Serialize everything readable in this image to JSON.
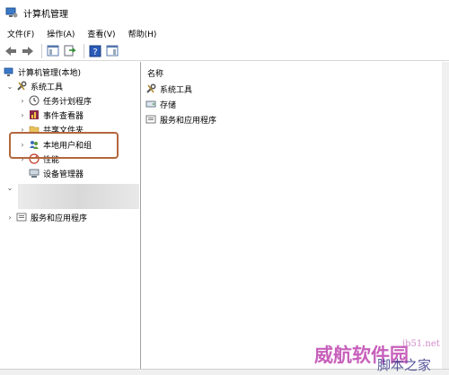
{
  "window": {
    "title": "计算机管理"
  },
  "menu": [
    {
      "label": "文件(F)"
    },
    {
      "label": "操作(A)"
    },
    {
      "label": "查看(V)"
    },
    {
      "label": "帮助(H)"
    }
  ],
  "toolbar": {
    "icons": [
      "back-arrow-icon",
      "forward-arrow-icon",
      "show-hide-tree-icon",
      "export-list-icon",
      "help-icon",
      "properties-icon"
    ]
  },
  "tree": {
    "root": "计算机管理(本地)",
    "system_tools": "系统工具",
    "task_scheduler": "任务计划程序",
    "event_viewer": "事件查看器",
    "shared_folders": "共享文件夹",
    "local_users": "本地用户和组",
    "performance": "性能",
    "device_manager": "设备管理器",
    "services_apps": "服务和应用程序"
  },
  "list": {
    "column_name": "名称",
    "items": [
      {
        "label": "系统工具"
      },
      {
        "label": "存储"
      },
      {
        "label": "服务和应用程序"
      }
    ]
  },
  "watermarks": {
    "site": "jb51.net",
    "brand": "威航软件园",
    "tagline": "脚本之家"
  },
  "colors": {
    "highlight": "#b3673c",
    "watermark": "#c24fb4"
  }
}
